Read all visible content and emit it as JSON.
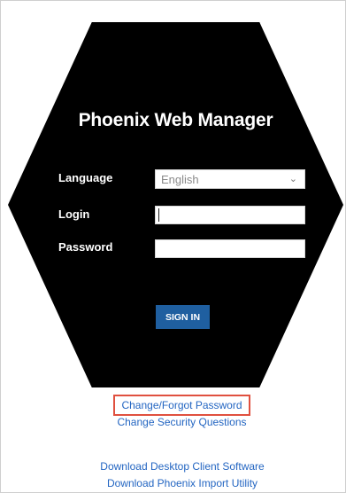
{
  "app": {
    "title": "Phoenix Web Manager"
  },
  "form": {
    "language_label": "Language",
    "language_value": "English",
    "login_label": "Login",
    "login_value": "",
    "password_label": "Password",
    "password_value": "",
    "signin_label": "SIGN IN"
  },
  "links": {
    "change_forgot_password": "Change/Forgot Password",
    "change_security_questions": "Change Security Questions",
    "download_desktop_client": "Download Desktop Client Software",
    "download_import_utility": "Download Phoenix Import Utility"
  },
  "icons": {
    "select_chevron": "chevron-down-icon"
  },
  "colors": {
    "hexagon_bg": "#000000",
    "button_bg": "#1f5fa0",
    "link": "#2466c2",
    "highlight_border": "#e0503f"
  }
}
